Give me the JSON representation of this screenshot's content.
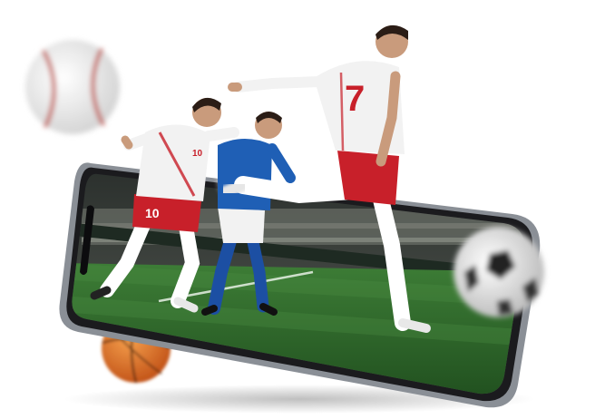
{
  "scene": {
    "description_visible_text": "",
    "players": [
      {
        "name": "player-red-white-10",
        "jersey_number": "10",
        "kit_colors": {
          "shirt": "#f2f2f2",
          "shorts": "#c8202a",
          "socks": "#ffffff"
        }
      },
      {
        "name": "player-blue",
        "jersey_number": "",
        "kit_colors": {
          "shirt": "#1f5fb5",
          "shorts": "#f2f2f2",
          "socks": "#1c4fa3"
        }
      },
      {
        "name": "player-red-white-7",
        "jersey_number": "7",
        "kit_colors": {
          "shirt": "#f2f2f2",
          "shorts": "#c8202a",
          "socks": "#ffffff"
        }
      }
    ],
    "balls": [
      {
        "kind": "baseball",
        "color": "#f0f0f0",
        "stitch_color": "#c0392b"
      },
      {
        "kind": "basketball",
        "color": "#e67e22"
      },
      {
        "kind": "soccer-ball",
        "color": "#eeeeee"
      }
    ],
    "colors": {
      "phone_frame": "#1b1b1e",
      "phone_rim": "#8a8f96",
      "pitch_green": "#2e6b2a",
      "pitch_dark": "#1d4a1c",
      "stand_crowd": "#3a3f3a"
    }
  }
}
